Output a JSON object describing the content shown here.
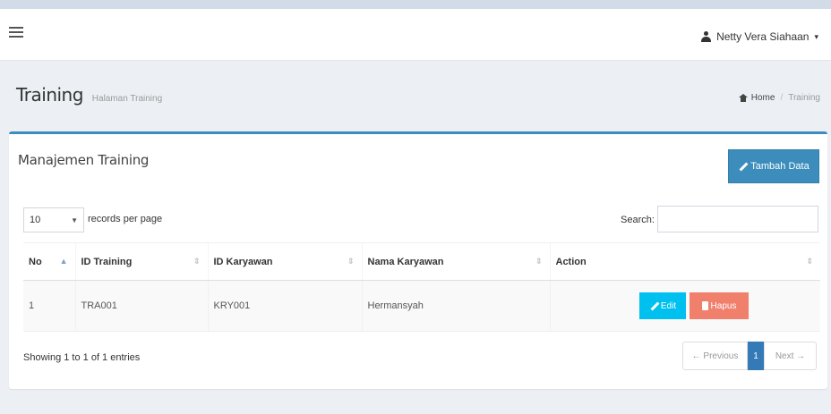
{
  "navbar": {
    "user_name": "Netty Vera Siahaan",
    "caret": "▾"
  },
  "header": {
    "title": "Training",
    "subtitle": "Halaman Training",
    "breadcrumb": {
      "home": "Home",
      "separator": "/",
      "current": "Training"
    }
  },
  "box": {
    "title": "Manajemen Training",
    "add_button": "Tambah Data"
  },
  "table_controls": {
    "length_value": "10",
    "length_label": "records per page",
    "search_label": "Search:",
    "search_value": ""
  },
  "table": {
    "columns": [
      "No",
      "ID Training",
      "ID Karyawan",
      "Nama Karyawan",
      "Action"
    ],
    "rows": [
      {
        "no": "1",
        "id_training": "TRA001",
        "id_karyawan": "KRY001",
        "nama_karyawan": "Hermansyah"
      }
    ],
    "edit_label": "Edit",
    "delete_label": "Hapus"
  },
  "footer": {
    "info": "Showing 1 to 1 of 1 entries",
    "prev": "← Previous",
    "page": "1",
    "next": "Next →"
  },
  "colors": {
    "primary": "#3c8dbc",
    "info": "#00c0ef",
    "danger": "#f07f6c",
    "page_active": "#337ab7"
  }
}
